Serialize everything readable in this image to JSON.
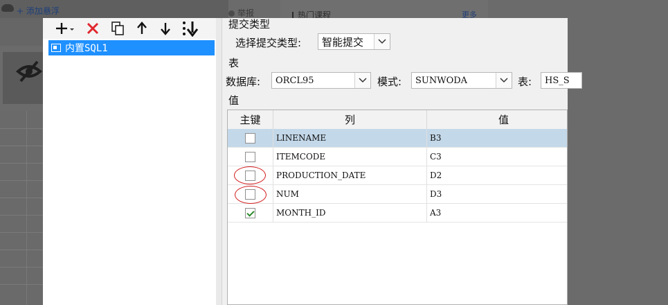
{
  "background": {
    "add_hover_label": "+ 添加悬浮",
    "report_label": "举报",
    "hot_courses_label": "热门课程",
    "more_label": "更多"
  },
  "left_panel": {
    "toolbar": {
      "add_icon": "plus-dropdown-icon",
      "delete_icon": "red-x-icon",
      "copy_icon": "copy-icon",
      "up_icon": "arrow-up-icon",
      "down_icon": "arrow-down-icon",
      "sort_icon": "sort-down-icon"
    },
    "tree_items": [
      {
        "label": "内置SQL1",
        "icon": "sql-dataset-icon",
        "selected": true
      }
    ]
  },
  "submit_type": {
    "section_label": "提交类型",
    "select_label": "选择提交类型:",
    "select_value": "智能提交"
  },
  "table_section": {
    "section_label": "表",
    "database_label": "数据库:",
    "database_value": "ORCL95",
    "schema_label": "模式:",
    "schema_value": "SUNWODA",
    "table_label": "表:",
    "table_value": "HS_S"
  },
  "value_section": {
    "section_label": "值",
    "columns": [
      "主键",
      "列",
      "值"
    ],
    "rows": [
      {
        "key": false,
        "column": "LINENAME",
        "value": "B3",
        "selected": true
      },
      {
        "key": false,
        "column": "ITEMCODE",
        "value": "C3",
        "selected": false
      },
      {
        "key": false,
        "column": "PRODUCTION_DATE",
        "value": "D2",
        "selected": false
      },
      {
        "key": false,
        "column": "NUM",
        "value": "D3",
        "selected": false
      },
      {
        "key": true,
        "column": "MONTH_ID",
        "value": "A3",
        "selected": false
      }
    ]
  },
  "colors": {
    "tree_selected": "#1e90ff",
    "row_selected": "#c3d8e9",
    "annotation_circle": "#d21a1a",
    "delete_icon": "#e0282e",
    "check_mark": "#2c8a2c"
  }
}
